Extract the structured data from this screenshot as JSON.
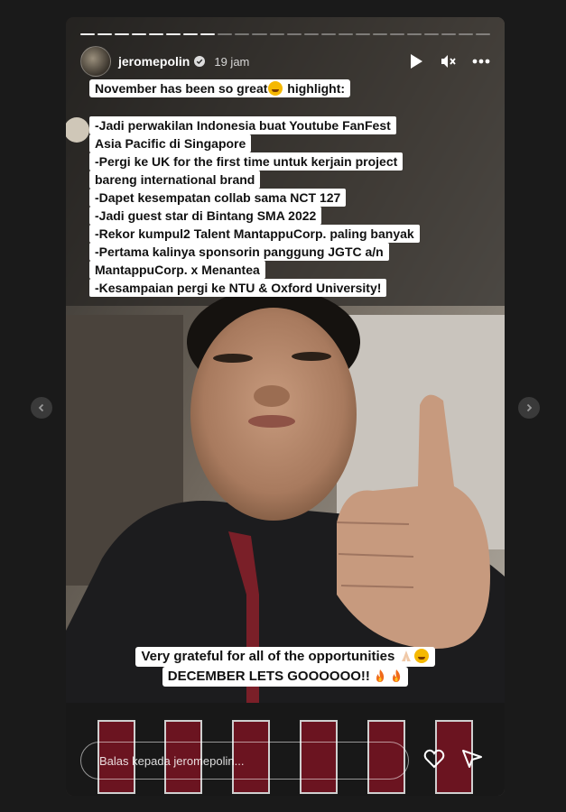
{
  "story": {
    "progress_segments": 24,
    "progress_done": 8,
    "username": "jeromepolin",
    "time": "19 jam"
  },
  "caption": {
    "title": "November has been so great",
    "title_suffix": " highlight:",
    "lines": [
      "-Jadi perwakilan Indonesia buat Youtube FanFest",
      "Asia Pacific di Singapore",
      "-Pergi ke UK for the first time untuk kerjain project",
      "bareng international brand",
      "-Dapet kesempatan collab sama NCT 127",
      "-Jadi guest star di Bintang SMA 2022",
      "-Rekor kumpul2 Talent MantappuCorp. paling banyak",
      "-Pertama kalinya sponsorin panggung JGTC a/n",
      "MantappuCorp. x Menantea",
      "-Kesampaian pergi ke NTU & Oxford University!"
    ],
    "bottom_line1": "Very grateful for all of the opportunities",
    "bottom_line2": "DECEMBER LETS GOOOOOO!!"
  },
  "reply": {
    "placeholder": "Balas kepada jeromepolin..."
  },
  "icons": {
    "play": "play-icon",
    "mute": "mute-icon",
    "more": "more-icon",
    "heart": "heart-icon",
    "send": "send-icon"
  }
}
